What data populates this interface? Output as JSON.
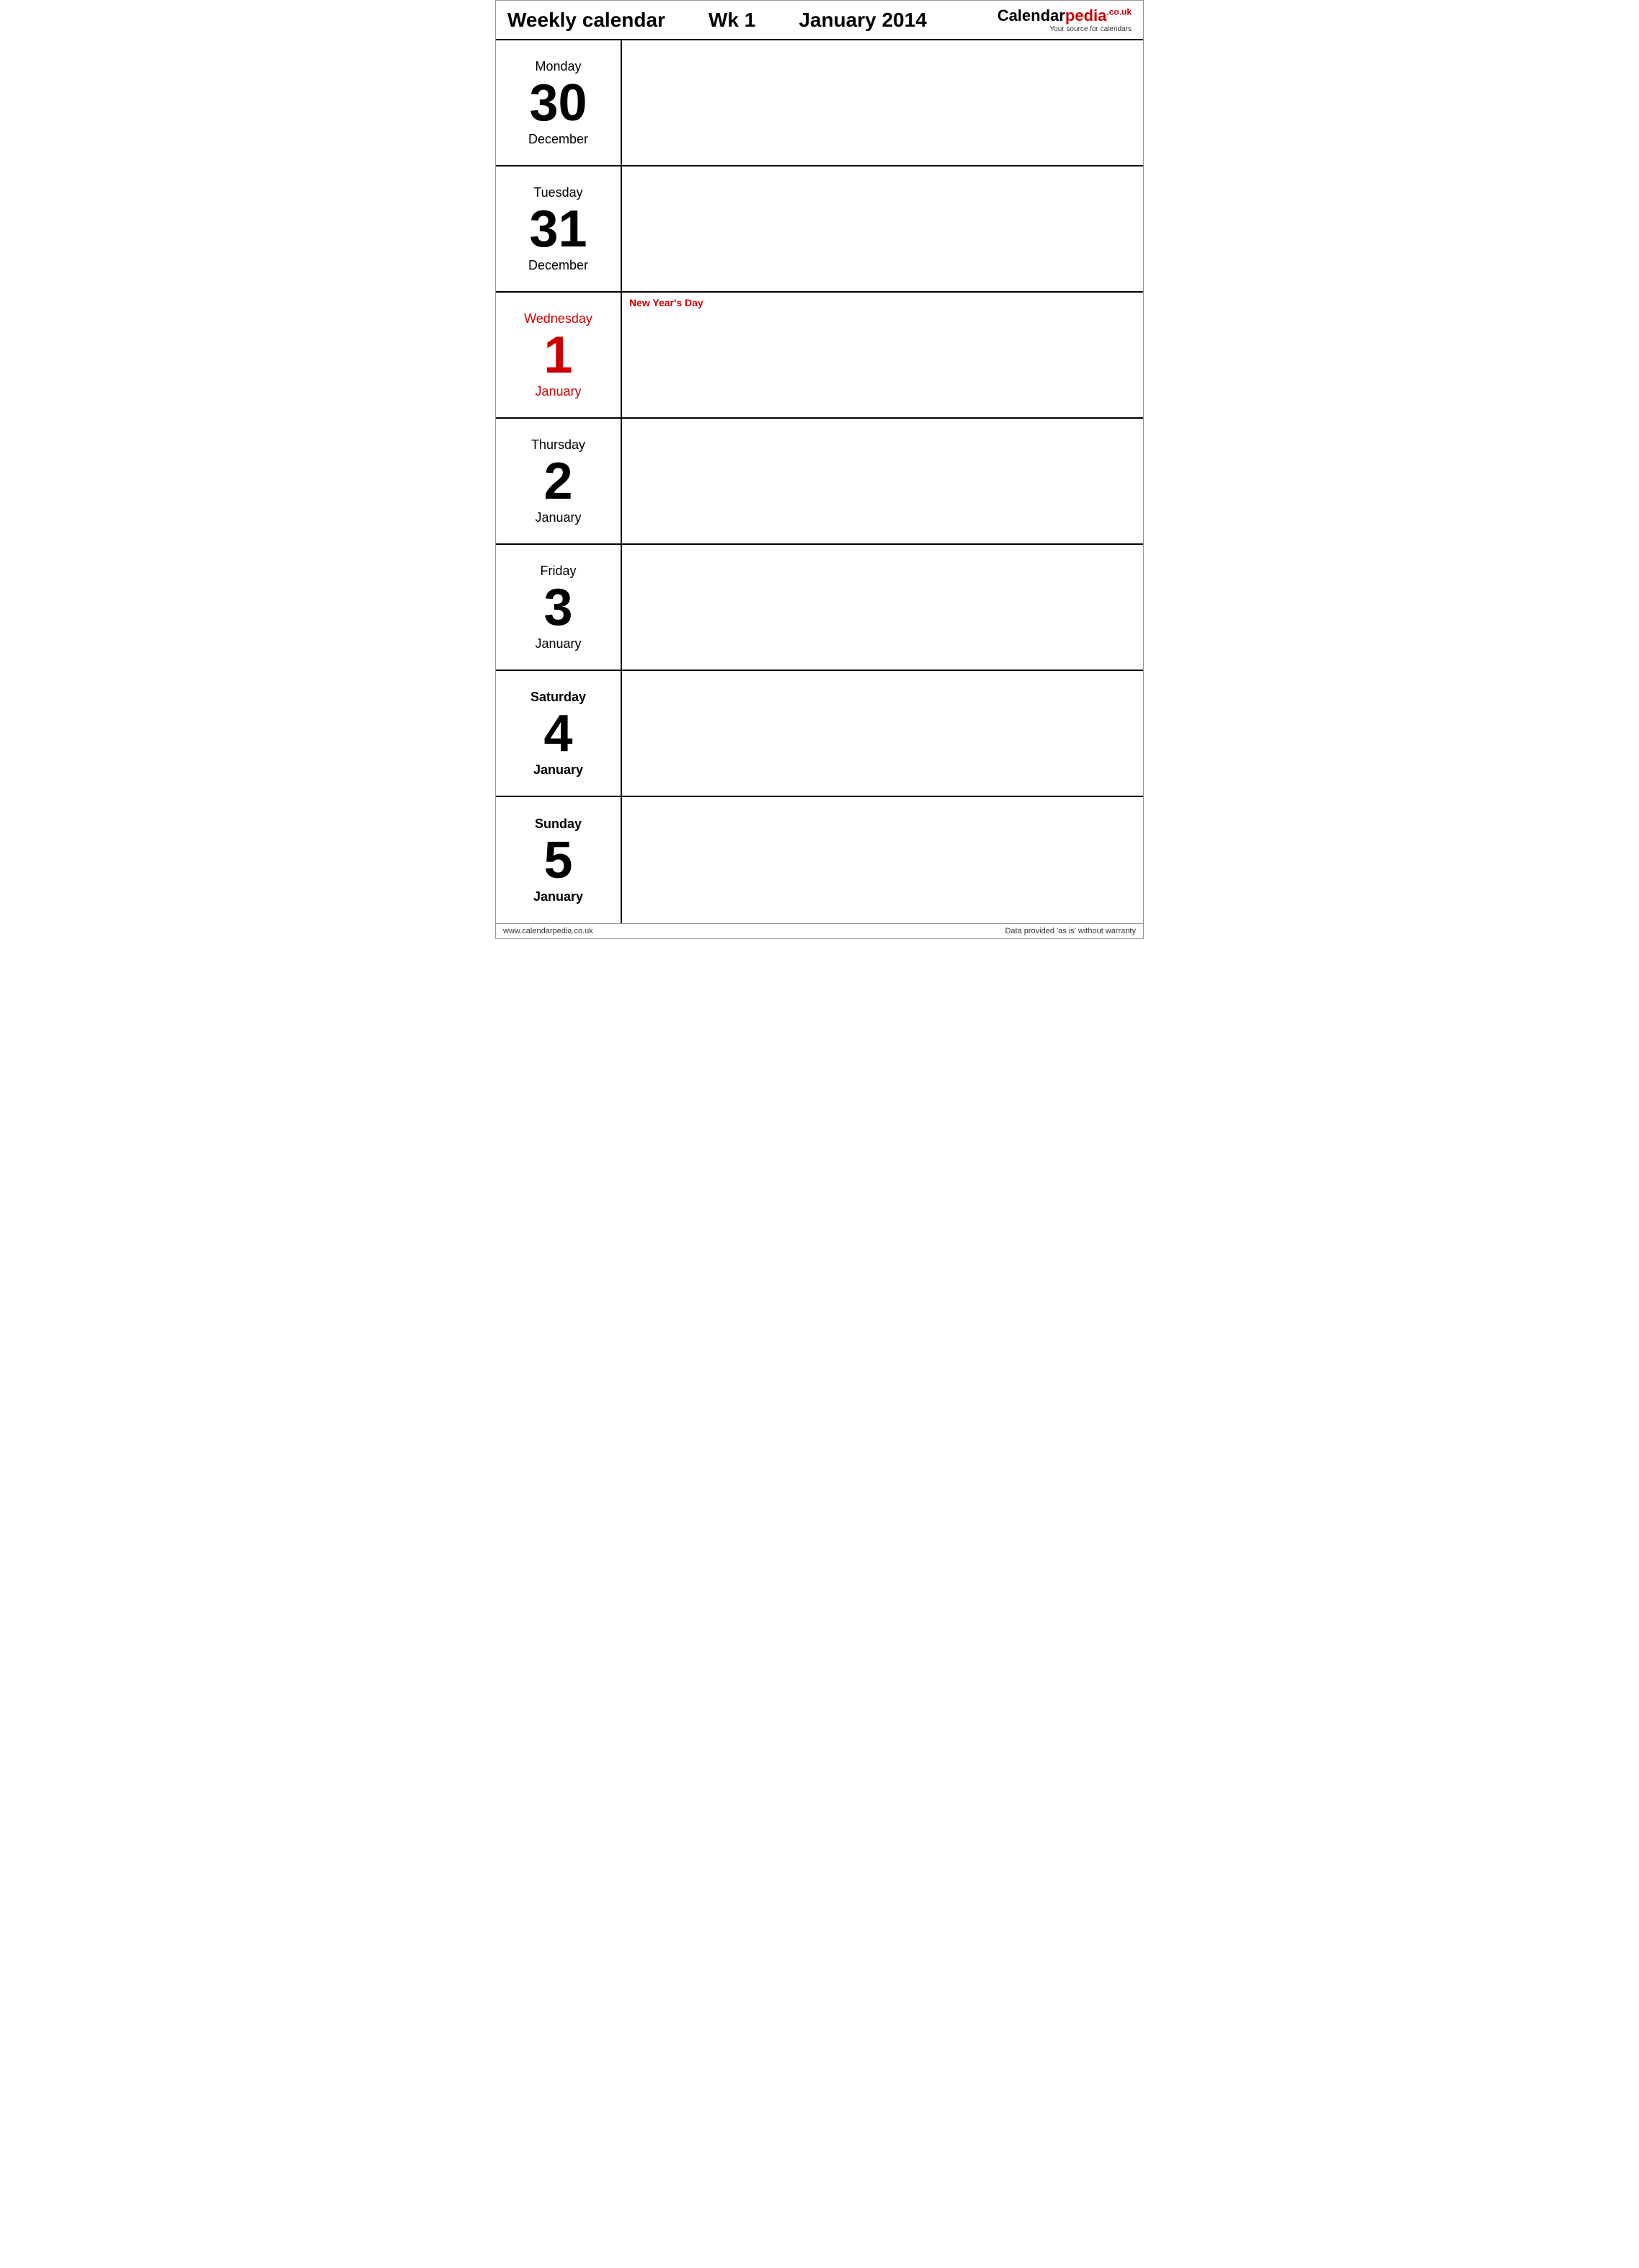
{
  "header": {
    "title": "Weekly calendar",
    "wk_label": "Wk 1",
    "month_year": "January 2014",
    "logo_main": "Calendar",
    "logo_red": "pedia",
    "logo_co": ".co.uk",
    "logo_sub": "Your source for calendars"
  },
  "days": [
    {
      "id": "monday",
      "day_name": "Monday",
      "day_number": "30",
      "day_month": "December",
      "holiday": false,
      "weekend": false,
      "holiday_name": ""
    },
    {
      "id": "tuesday",
      "day_name": "Tuesday",
      "day_number": "31",
      "day_month": "December",
      "holiday": false,
      "weekend": false,
      "holiday_name": ""
    },
    {
      "id": "wednesday",
      "day_name": "Wednesday",
      "day_number": "1",
      "day_month": "January",
      "holiday": true,
      "weekend": false,
      "holiday_name": "New Year's Day"
    },
    {
      "id": "thursday",
      "day_name": "Thursday",
      "day_number": "2",
      "day_month": "January",
      "holiday": false,
      "weekend": false,
      "holiday_name": ""
    },
    {
      "id": "friday",
      "day_name": "Friday",
      "day_number": "3",
      "day_month": "January",
      "holiday": false,
      "weekend": false,
      "holiday_name": ""
    },
    {
      "id": "saturday",
      "day_name": "Saturday",
      "day_number": "4",
      "day_month": "January",
      "holiday": false,
      "weekend": true,
      "holiday_name": ""
    },
    {
      "id": "sunday",
      "day_name": "Sunday",
      "day_number": "5",
      "day_month": "January",
      "holiday": false,
      "weekend": true,
      "holiday_name": ""
    }
  ],
  "footer": {
    "left": "www.calendarpedia.co.uk",
    "right": "Data provided 'as is' without warranty"
  }
}
